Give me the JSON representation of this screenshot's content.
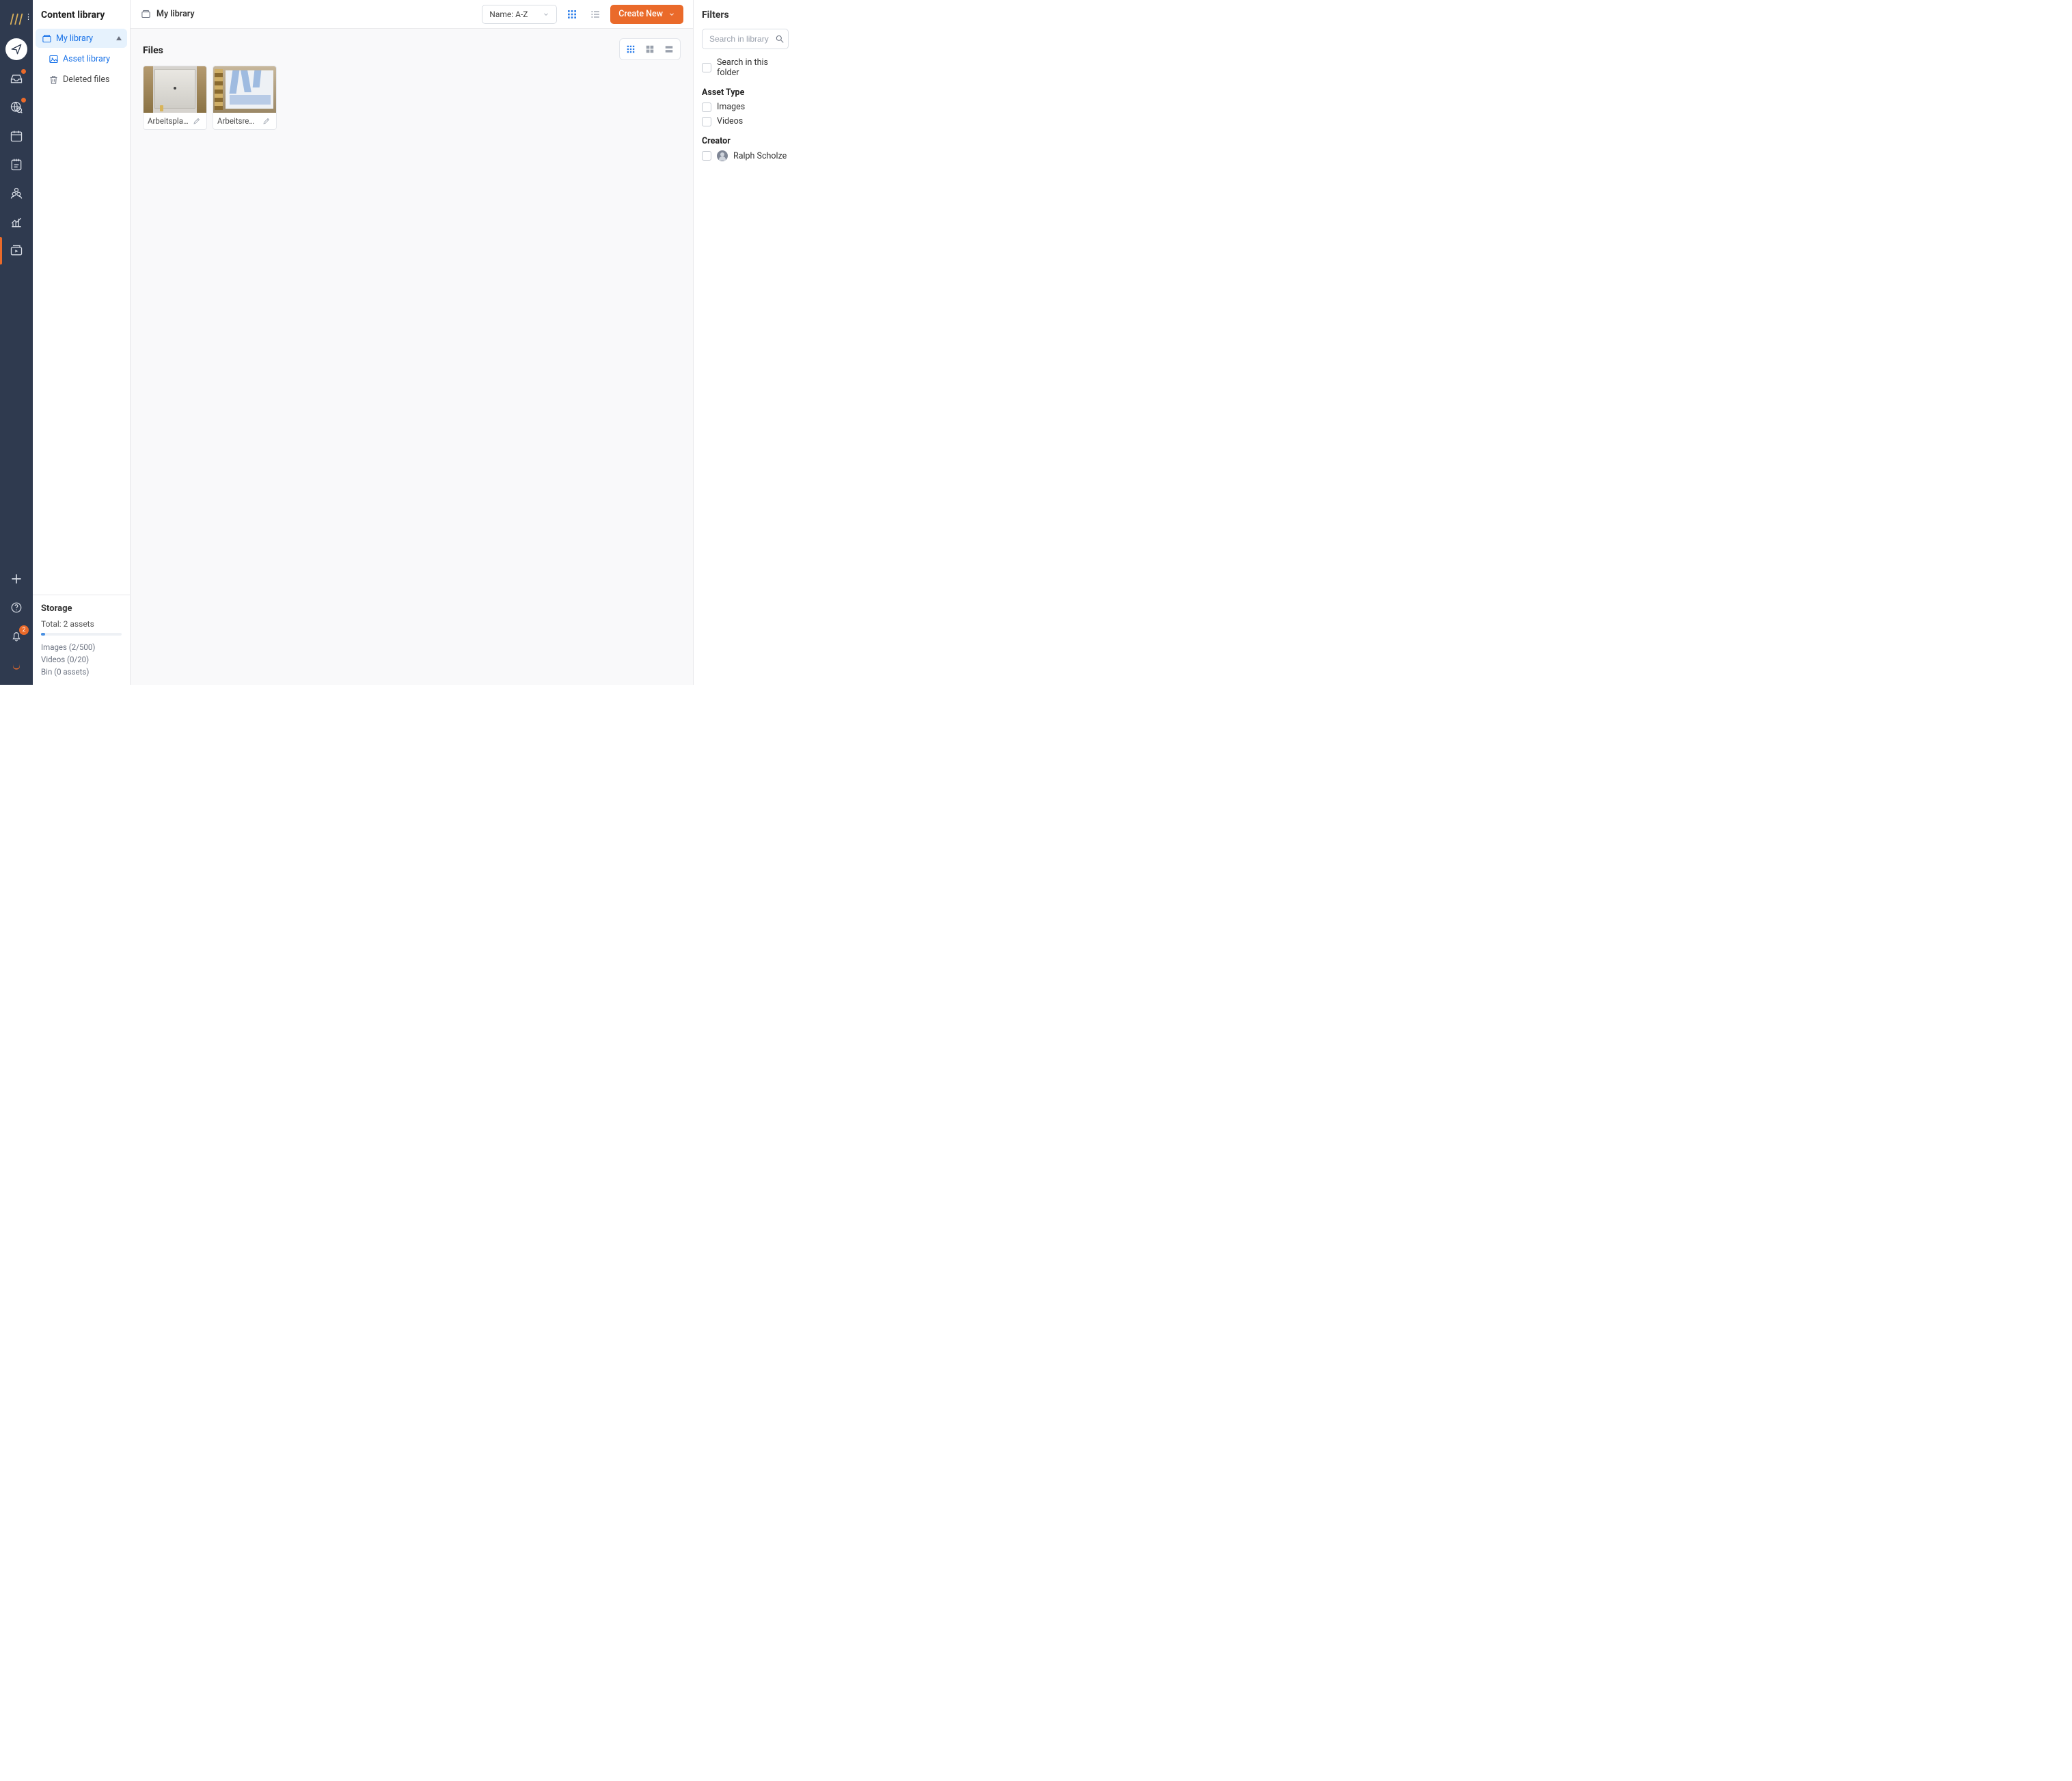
{
  "sidebar": {
    "title": "Content library",
    "tree": {
      "my_library": "My library",
      "asset_library": "Asset library",
      "deleted_files": "Deleted files"
    }
  },
  "storage": {
    "title": "Storage",
    "total": "Total: 2 assets",
    "images": "Images (2/500)",
    "videos": "Videos (0/20)",
    "bin": "Bin (0 assets)"
  },
  "header": {
    "breadcrumb": "My library",
    "sort_label": "Name: A-Z",
    "create_label": "Create New"
  },
  "content": {
    "section_title": "Files",
    "files": [
      {
        "name": "Arbeitspla..."
      },
      {
        "name": "Arbeitsrec..."
      }
    ]
  },
  "filters": {
    "title": "Filters",
    "search_placeholder": "Search in library",
    "search_in_folder": "Search in this folder",
    "asset_type_title": "Asset Type",
    "images": "Images",
    "videos": "Videos",
    "creator_title": "Creator",
    "creator_name": "Ralph Scholze"
  },
  "nav": {
    "notification_count": "2"
  }
}
